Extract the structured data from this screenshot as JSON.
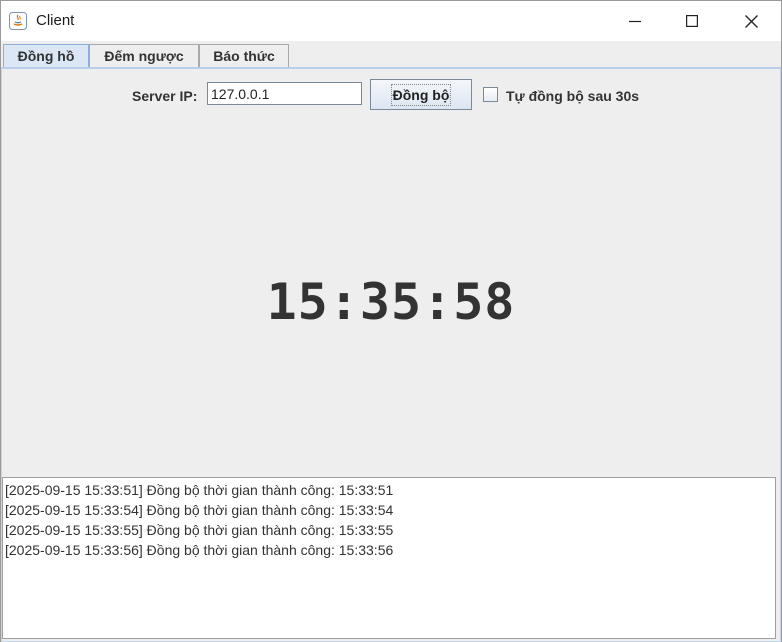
{
  "window": {
    "title": "Client"
  },
  "tabs": [
    {
      "label": "Đồng hồ",
      "active": true
    },
    {
      "label": "Đếm ngược",
      "active": false
    },
    {
      "label": "Báo thức",
      "active": false
    }
  ],
  "connection": {
    "label": "Server IP:",
    "ip_value": "127.0.0.1",
    "sync_button": "Đồng bộ",
    "auto_sync_label": "Tự đồng bộ sau 30s",
    "auto_sync_checked": false
  },
  "clock": {
    "time": "15:35:58"
  },
  "log": [
    "[2025-09-15 15:33:51] Đồng bộ thời gian thành công: 15:33:51",
    "[2025-09-15 15:33:54] Đồng bộ thời gian thành công: 15:33:54",
    "[2025-09-15 15:33:55] Đồng bộ thời gian thành công: 15:33:55",
    "[2025-09-15 15:33:56] Đồng bộ thời gian thành công: 15:33:56"
  ],
  "colors": {
    "active_tab": "#dbe7f4",
    "panel_bg": "#eeeeee",
    "text": "#333333"
  }
}
